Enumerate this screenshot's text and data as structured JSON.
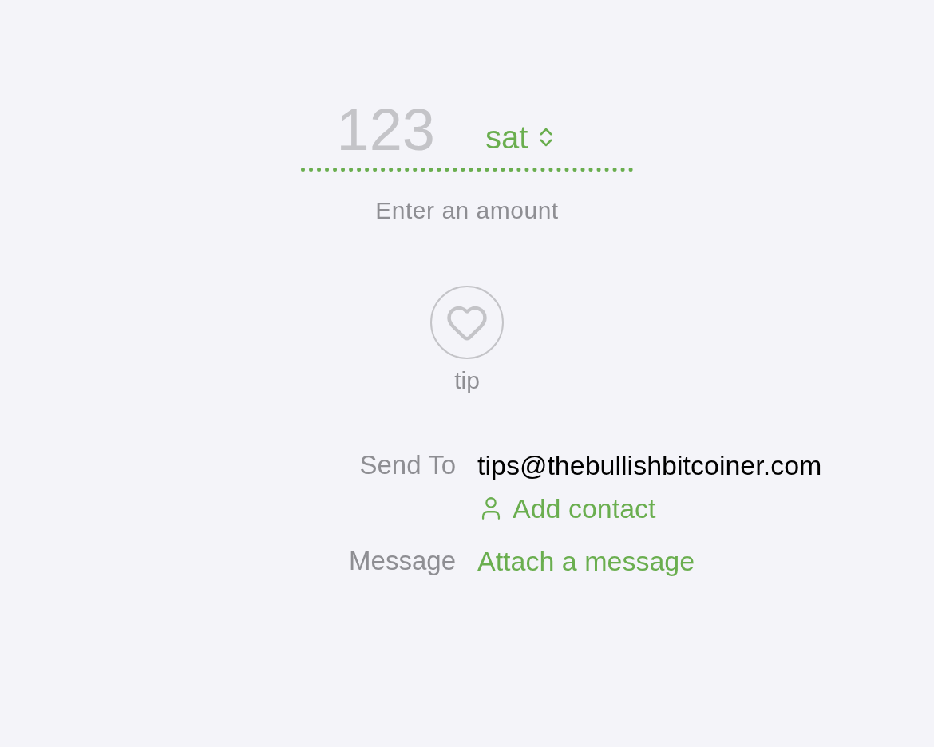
{
  "amount": {
    "placeholder": "123",
    "unit": "sat",
    "hint": "Enter an amount"
  },
  "tip_button": {
    "label": "tip"
  },
  "fields": [
    {
      "kind": "recipient",
      "label": "Send To",
      "value": "tips@thebullishbitcoiner.com",
      "action": "Add contact"
    },
    {
      "kind": "message",
      "label": "Message",
      "action": "Attach a message"
    }
  ]
}
